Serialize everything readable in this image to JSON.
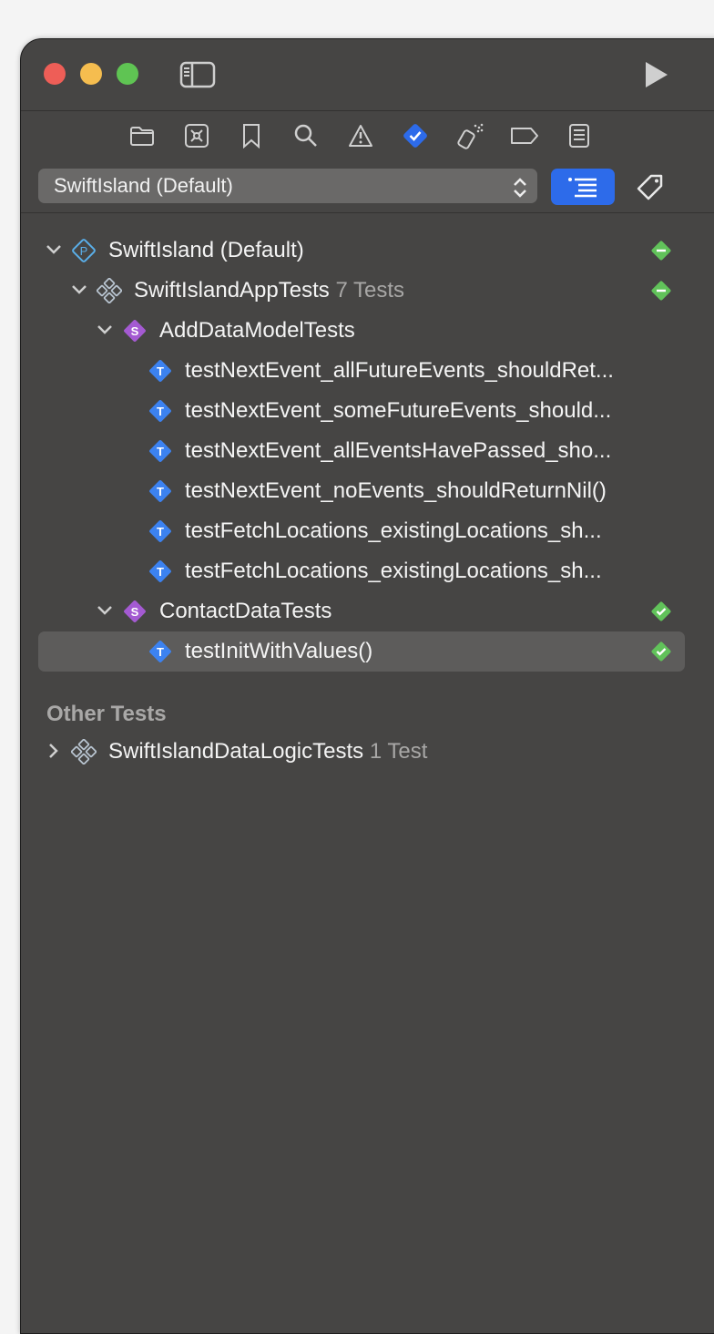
{
  "colors": {
    "window_bg": "#464544",
    "accent": "#2d6bea",
    "pass": "#61c25a",
    "skip": "#61c25a",
    "test_icon": "#3c82f0",
    "suite_icon": "#a45ad2",
    "project_icon": "#5aaee8"
  },
  "titlebar": {
    "icons": [
      "close-icon",
      "minimize-icon",
      "zoom-icon",
      "sidebar-toggle-icon",
      "run-icon"
    ]
  },
  "navigator": {
    "tabs": [
      "folder-icon",
      "source-control-icon",
      "bookmark-icon",
      "search-icon",
      "warning-icon",
      "test-navigator-icon",
      "debug-icon",
      "breakpoint-icon",
      "report-icon"
    ],
    "active_tab": "test-navigator-icon"
  },
  "scheme": {
    "selected": "SwiftIsland (Default)"
  },
  "tree": {
    "plan": {
      "label": "SwiftIsland (Default)",
      "status": "skipped"
    },
    "target": {
      "label": "SwiftIslandAppTests",
      "count": "7 Tests",
      "status": "skipped"
    },
    "suite1": {
      "label": "AddDataModelTests"
    },
    "tests1": [
      "testNextEvent_allFutureEvents_shouldRet...",
      "testNextEvent_someFutureEvents_should...",
      "testNextEvent_allEventsHavePassed_sho...",
      "testNextEvent_noEvents_shouldReturnNil()",
      "testFetchLocations_existingLocations_sh...",
      "testFetchLocations_existingLocations_sh..."
    ],
    "suite2": {
      "label": "ContactDataTests",
      "status": "passed"
    },
    "test2": {
      "label": "testInitWithValues()",
      "status": "passed"
    }
  },
  "other": {
    "title": "Other Tests",
    "target": {
      "label": "SwiftIslandDataLogicTests",
      "count": "1 Test"
    }
  }
}
